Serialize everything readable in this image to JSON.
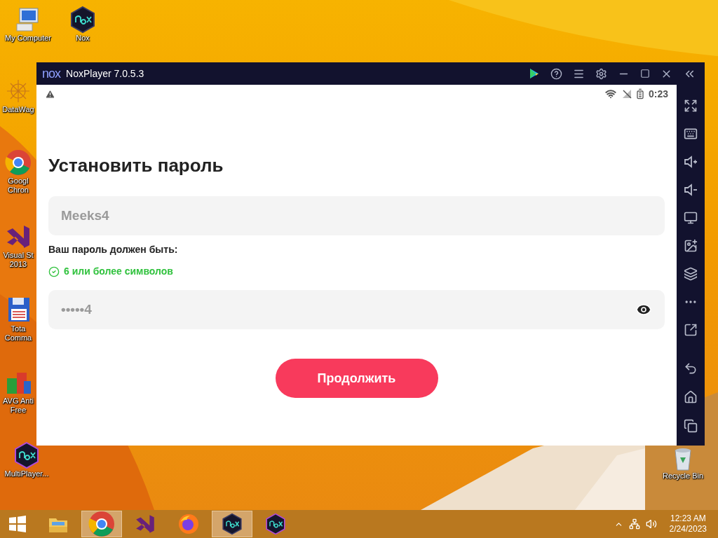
{
  "desktop_icons": [
    {
      "kind": "computer",
      "label": [
        "My Computer"
      ]
    },
    {
      "kind": "nox",
      "label": [
        "Nox"
      ]
    },
    {
      "kind": "datawag",
      "label": [
        "DataWag"
      ]
    },
    {
      "kind": "chrome",
      "label": [
        "Googl",
        "Chron"
      ]
    },
    {
      "kind": "vs",
      "label": [
        "Visual St",
        "2013"
      ]
    },
    {
      "kind": "floppy",
      "label": [
        "Tota",
        "Comma"
      ]
    },
    {
      "kind": "avg",
      "label": [
        "AVG Anti",
        "Free"
      ]
    },
    {
      "kind": "multinox",
      "label": [
        "MultiPlayer..."
      ]
    },
    {
      "kind": "recycle",
      "label": [
        "Recycle Bin"
      ]
    }
  ],
  "window": {
    "logo": "nox",
    "title": "NoxPlayer 7.0.5.3"
  },
  "android": {
    "status_time": "0:23",
    "heading": "Установить пароль",
    "username_field": {
      "value": "Meeks4"
    },
    "rules_title": "Ваш пароль должен быть:",
    "rules": [
      {
        "text": "6 или более символов",
        "met": true
      }
    ],
    "password_field": {
      "value": "•••••4"
    },
    "button": "Продолжить"
  },
  "taskbar": {
    "items": [
      {
        "kind": "explorer",
        "selected": false
      },
      {
        "kind": "chrome",
        "selected": true
      },
      {
        "kind": "vs",
        "selected": false
      },
      {
        "kind": "firefox",
        "selected": false
      },
      {
        "kind": "nox",
        "selected": true
      },
      {
        "kind": "multinox",
        "selected": false
      }
    ],
    "time": "12:23 AM",
    "date": "2/24/2023"
  }
}
